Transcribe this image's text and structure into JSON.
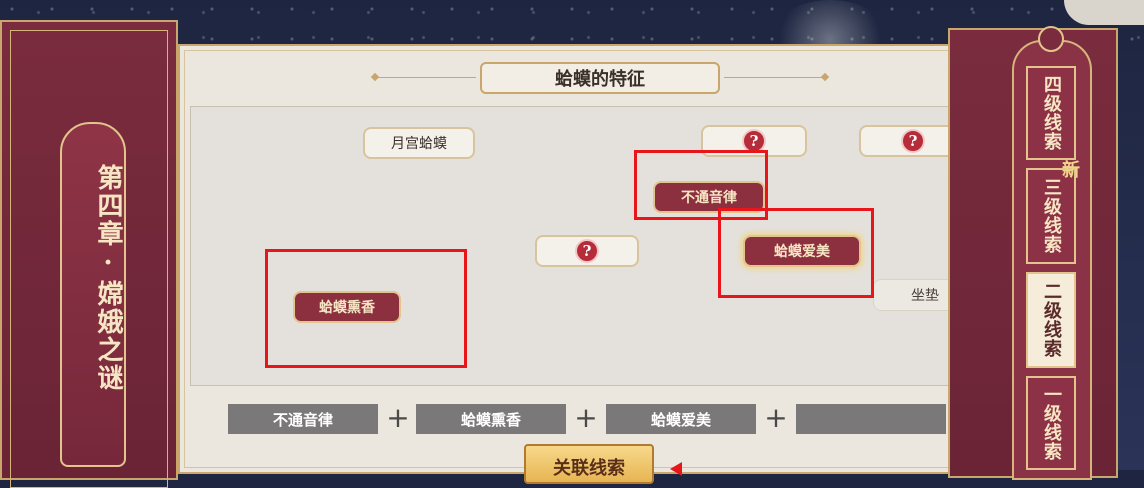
{
  "chapter": {
    "title": "第四章·嫦娥之谜"
  },
  "panel": {
    "title": "蛤蟆的特征"
  },
  "board": {
    "nodes": [
      {
        "id": "n1",
        "label": "月宫蛤蟆",
        "state": "plain"
      },
      {
        "id": "n2",
        "label": "?",
        "state": "unknown"
      },
      {
        "id": "n3",
        "label": "?",
        "state": "unknown"
      },
      {
        "id": "n4",
        "label": "不通音律",
        "state": "red"
      },
      {
        "id": "n5",
        "label": "?",
        "state": "unknown"
      },
      {
        "id": "n6",
        "label": "蛤蟆爱美",
        "state": "red-glow"
      },
      {
        "id": "n7",
        "label": "蛤蟆熏香",
        "state": "red"
      },
      {
        "id": "n8",
        "label": "坐垫",
        "state": "faded"
      }
    ]
  },
  "formula": {
    "slots": [
      "不通音律",
      "蛤蟆熏香",
      "蛤蟆爱美",
      ""
    ],
    "plus": "+"
  },
  "link_button": {
    "label": "关联线索"
  },
  "clue_tabs": [
    {
      "label": "四级线索",
      "active": false
    },
    {
      "label": "三级线索",
      "active": false,
      "badge": "新"
    },
    {
      "label": "二级线索",
      "active": true
    },
    {
      "label": "一级线索",
      "active": false
    }
  ],
  "colors": {
    "highlight": "#e8151b",
    "node_red": "#8c3040",
    "gold": "#c9a66b",
    "panel_maroon": "#7a2c3e"
  }
}
